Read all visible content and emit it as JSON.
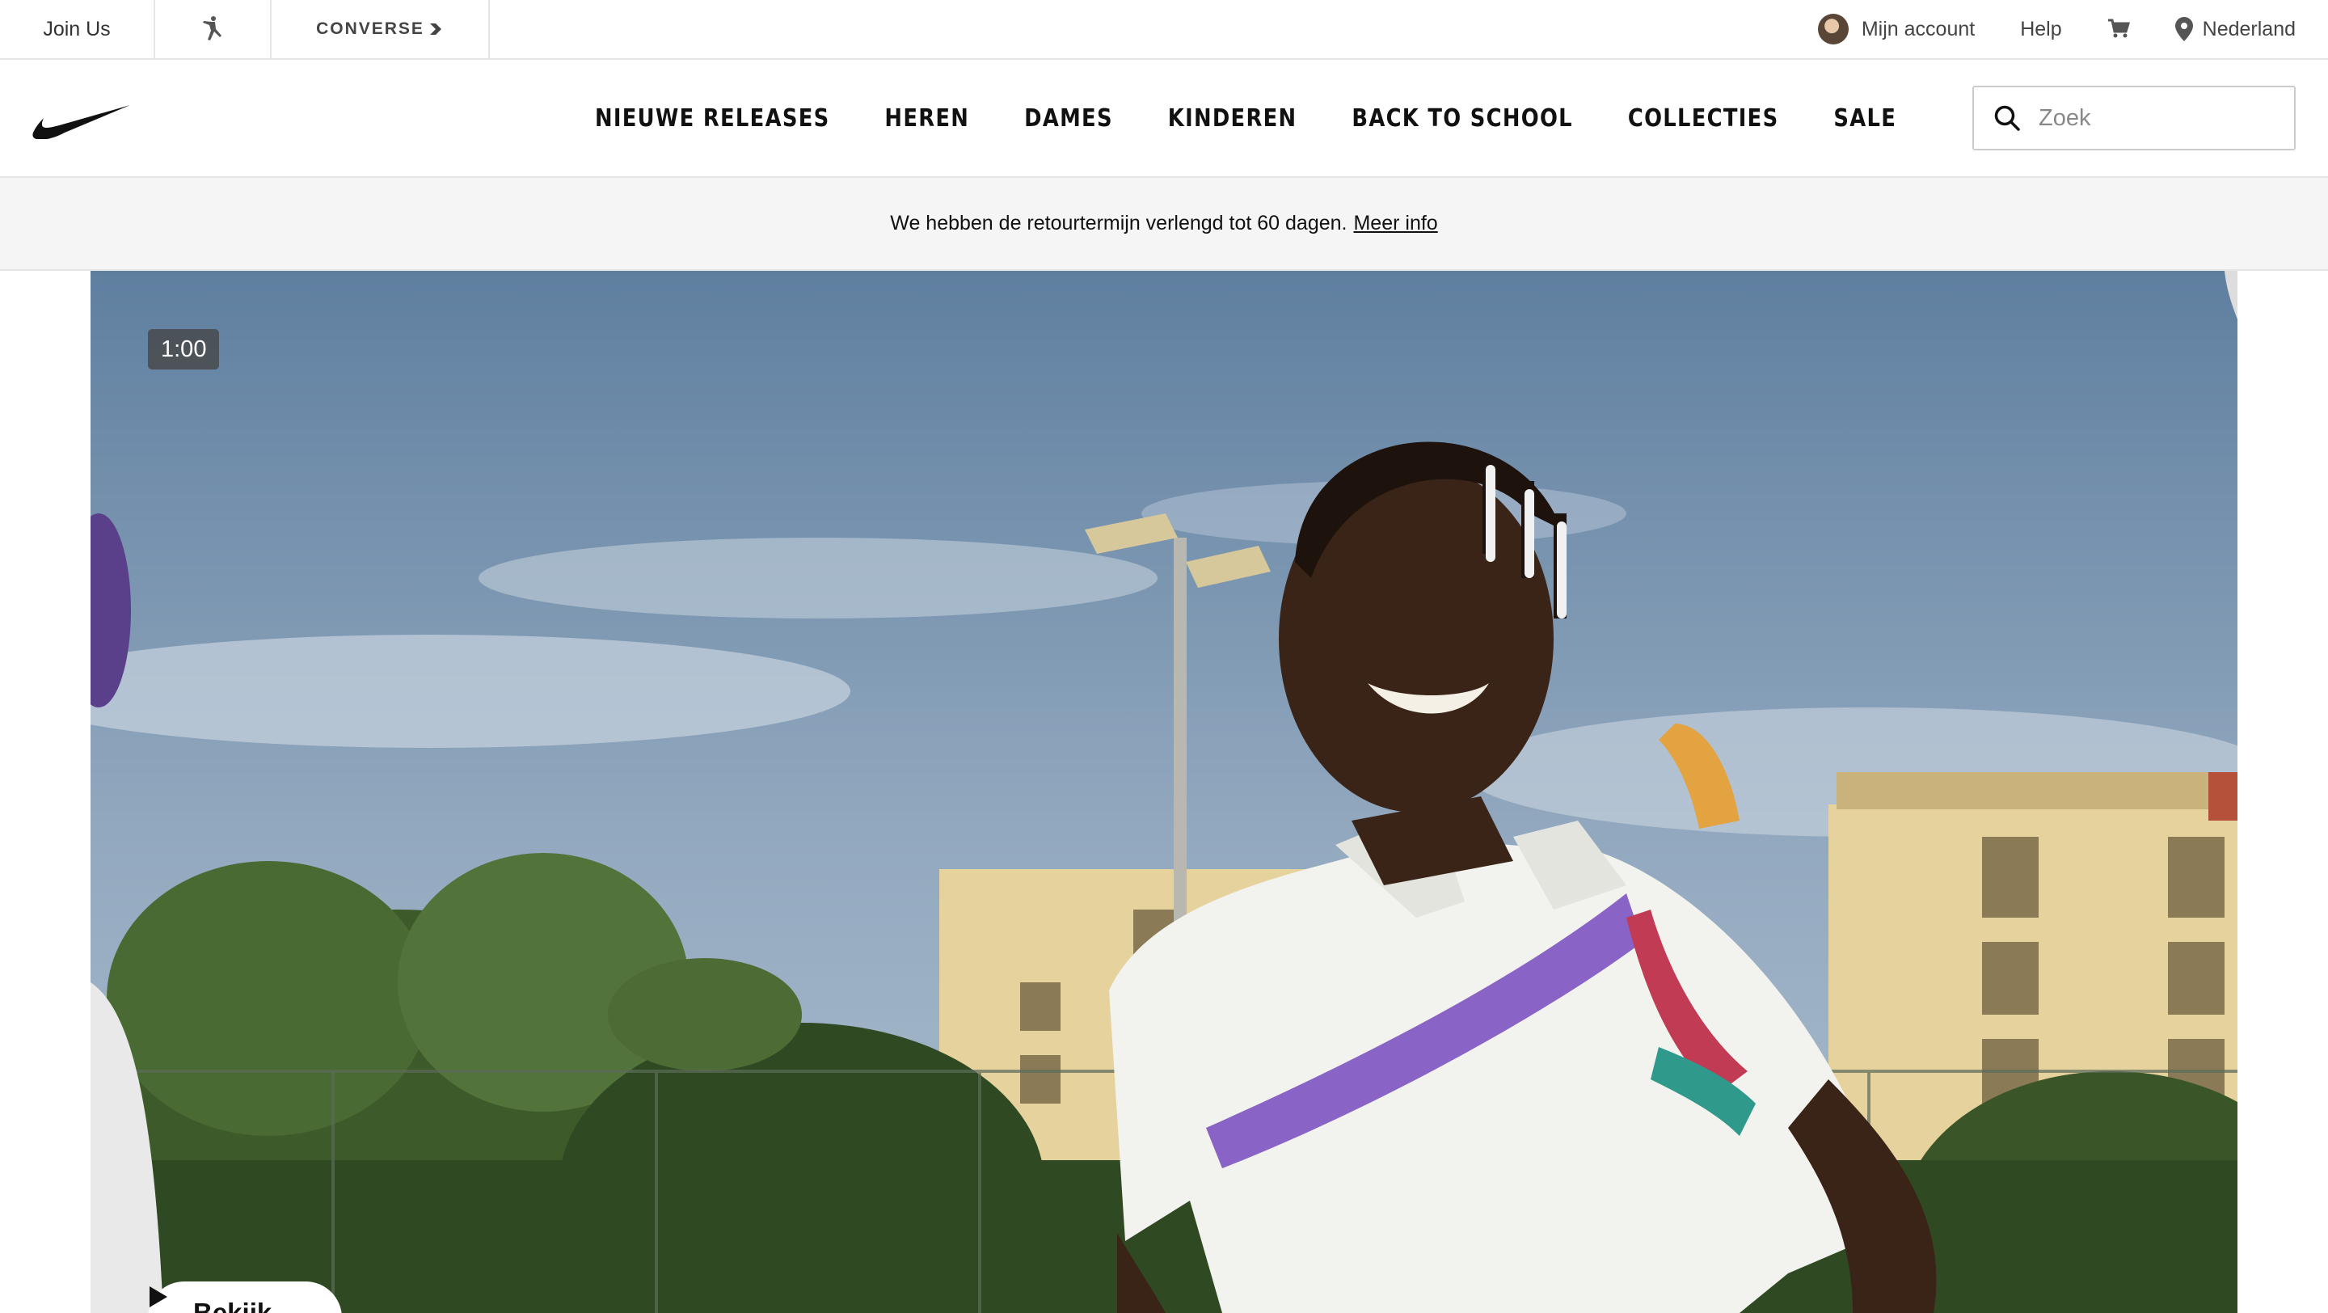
{
  "utility_bar": {
    "join_us": "Join Us",
    "jordan_icon": "jordan-jumpman-icon",
    "converse_label": "CONVERSE",
    "account_label": "Mijn account",
    "help_label": "Help",
    "cart_icon": "cart-icon",
    "location_label": "Nederland"
  },
  "nav": {
    "logo": "nike-swoosh-logo",
    "items": [
      {
        "label": "NIEUWE RELEASES"
      },
      {
        "label": "HEREN"
      },
      {
        "label": "DAMES"
      },
      {
        "label": "KINDEREN"
      },
      {
        "label": "BACK TO SCHOOL"
      },
      {
        "label": "COLLECTIES"
      },
      {
        "label": "SALE"
      }
    ],
    "search_placeholder": "Zoek"
  },
  "promo": {
    "text": "We hebben de retourtermijn verlengd tot 60 dagen.",
    "link_label": "Meer info"
  },
  "hero": {
    "duration": "1:00",
    "watch_label": "Bekijk",
    "colors": {
      "sky_top": "#5f7fa0",
      "sky_bottom": "#aebfd0",
      "building": "#e6d29c",
      "foliage": "#3d5a2a",
      "shirt": "#f2f2ee",
      "skin": "#3a2418",
      "accent_purple": "#8a63c6"
    }
  }
}
